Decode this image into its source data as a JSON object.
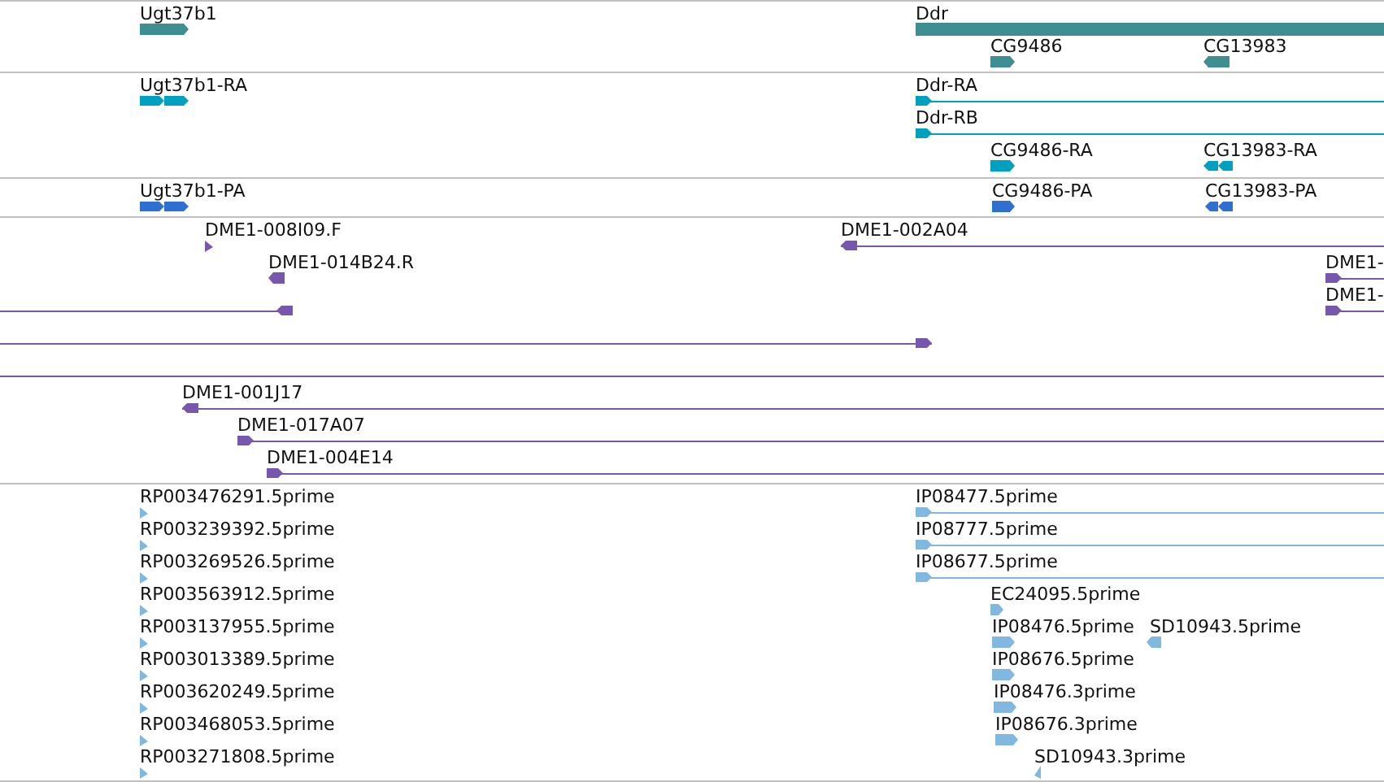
{
  "tracks": [
    {
      "kind": "gene",
      "features": [
        {
          "label": "Ugt37b1",
          "kind": "bar",
          "reverse": false
        },
        {
          "label": "Ddr",
          "kind": "bar"
        },
        {
          "label": "CG9486",
          "kind": "bar",
          "reverse": false
        },
        {
          "label": "CG13983",
          "kind": "bar",
          "reverse": true
        }
      ]
    },
    {
      "kind": "transcript",
      "features": [
        {
          "label": "Ugt37b1-RA",
          "kind": "exons",
          "reverse": false
        },
        {
          "label": "Ddr-RA",
          "kind": "line",
          "reverse": false
        },
        {
          "label": "Ddr-RB",
          "kind": "line",
          "reverse": false
        },
        {
          "label": "CG9486-RA",
          "kind": "bar",
          "reverse": false
        },
        {
          "label": "CG13983-RA",
          "kind": "exons",
          "reverse": true
        }
      ]
    },
    {
      "kind": "protein",
      "features": [
        {
          "label": "Ugt37b1-PA",
          "kind": "exons",
          "reverse": false
        },
        {
          "label": "CG9486-PA",
          "kind": "bar",
          "reverse": false
        },
        {
          "label": "CG13983-PA",
          "kind": "exons",
          "reverse": true
        }
      ]
    },
    {
      "kind": "clone",
      "features": [
        {
          "label": "DME1-008I09.F",
          "kind": "tick",
          "reverse": false
        },
        {
          "label": "DME1-002A04",
          "kind": "line",
          "reverse": true
        },
        {
          "label": "DME1-014B24.R",
          "kind": "bar",
          "reverse": true
        },
        {
          "label": "DME1-",
          "kind": "line",
          "reverse": false
        },
        {
          "kind": "line",
          "reverse": true
        },
        {
          "label": "DME1-",
          "kind": "line",
          "reverse": false
        },
        {
          "kind": "line",
          "reverse": false
        },
        {
          "kind": "line"
        },
        {
          "label": "DME1-001J17",
          "kind": "line",
          "reverse": true
        },
        {
          "label": "DME1-017A07",
          "kind": "line",
          "reverse": false
        },
        {
          "label": "DME1-004E14",
          "kind": "line",
          "reverse": false
        }
      ]
    },
    {
      "kind": "est",
      "features": [
        {
          "label": "RP003476291.5prime",
          "kind": "tick",
          "reverse": false
        },
        {
          "label": "IP08477.5prime",
          "kind": "line",
          "reverse": false
        },
        {
          "label": "RP003239392.5prime",
          "kind": "tick",
          "reverse": false
        },
        {
          "label": "IP08777.5prime",
          "kind": "line",
          "reverse": false
        },
        {
          "label": "RP003269526.5prime",
          "kind": "tick",
          "reverse": false
        },
        {
          "label": "IP08677.5prime",
          "kind": "line",
          "reverse": false
        },
        {
          "label": "RP003563912.5prime",
          "kind": "tick",
          "reverse": false
        },
        {
          "label": "EC24095.5prime",
          "kind": "bar",
          "reverse": false
        },
        {
          "label": "RP003137955.5prime",
          "kind": "tick",
          "reverse": false
        },
        {
          "label": "IP08476.5prime",
          "kind": "bar",
          "reverse": false
        },
        {
          "label": "SD10943.5prime",
          "kind": "bar",
          "reverse": true
        },
        {
          "label": "RP003013389.5prime",
          "kind": "tick",
          "reverse": false
        },
        {
          "label": "IP08676.5prime",
          "kind": "bar",
          "reverse": false
        },
        {
          "label": "RP003620249.5prime",
          "kind": "tick",
          "reverse": false
        },
        {
          "label": "IP08476.3prime",
          "kind": "bar",
          "reverse": false
        },
        {
          "label": "RP003468053.5prime",
          "kind": "tick",
          "reverse": false
        },
        {
          "label": "IP08676.3prime",
          "kind": "bar",
          "reverse": false
        },
        {
          "label": "RP003271808.5prime",
          "kind": "tick",
          "reverse": false
        },
        {
          "label": "SD10943.3prime",
          "kind": "tick",
          "reverse": true
        }
      ]
    }
  ]
}
